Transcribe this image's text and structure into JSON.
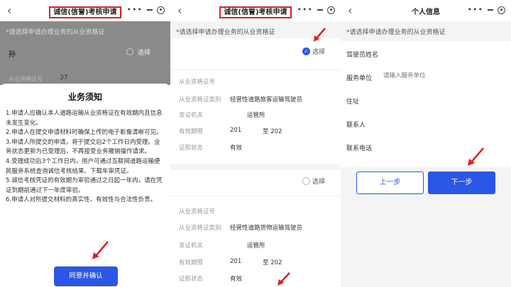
{
  "colors": {
    "accent": "#2b57e6",
    "highlight": "#e02020"
  },
  "screen1": {
    "nav_title": "诚信(信誉)考核申请",
    "hint": "*请选择申请办理业务的从业资格证",
    "dim_name": "孙",
    "dim_select": "选择",
    "dim_label": "从业资格证号",
    "dim_value": "37",
    "notice_title": "业务须知",
    "notice_items": [
      "1.申请人应确认本人道路运输从业资格证在有效期内且信息未发生变化。",
      "2.申请人在提交申请材料时确保上传的电子影像清晰可见。",
      "3.申请人所提交的申请，将于提交后2个工作日内受理。业务状态更新为已受理后，不再接受业务撤销操作请求。",
      "4.受理成功后3个工作日内，用户可通过互联网道路运输便民服务系统查询诚信考核结果、下载年审凭证。",
      "5.诚信考核凭证的有效期为审验通过之日起一年内，请在凭证到期前通过下一年度审验。",
      "6.申请人对所提交材料的真实性、有效性与合法性负责。"
    ],
    "agree_button": "同意并确认"
  },
  "screen2": {
    "nav_title": "诚信(信誉)考核申请",
    "hint": "*请选择申请办理业务的从业资格证",
    "card1": {
      "select": "选择",
      "radio_mark": "✓",
      "rows": [
        {
          "label": "从业资格证号",
          "value": ""
        },
        {
          "label": "从业资格证类别",
          "value": "经营性道路旅客运输驾驶员"
        },
        {
          "label": "发证机关",
          "value": "运管所"
        },
        {
          "label": "有效期限",
          "value": "201",
          "value2": "至 202"
        },
        {
          "label": "证照状态",
          "value": "有效"
        }
      ]
    },
    "card2": {
      "select": "选择",
      "rows": [
        {
          "label": "从业资格证号",
          "value": ""
        },
        {
          "label": "从业资格证类别",
          "value": "经营性道路货物运输驾驶员"
        },
        {
          "label": "发证机关",
          "value": "运管所"
        },
        {
          "label": "有效期限",
          "value": "201",
          "value2": "至 202"
        },
        {
          "label": "证照状态",
          "value": "有效"
        }
      ]
    }
  },
  "screen3": {
    "nav_title": "个人信息",
    "hint": "*请选择申请办理业务的从业资格证",
    "fields": [
      {
        "label": "驾驶员姓名"
      },
      {
        "label": "服务单位",
        "placeholder": "请输入服务单位"
      },
      {
        "label": "住址"
      },
      {
        "label": "联系人"
      },
      {
        "label": "联系电话"
      }
    ],
    "prev_button": "上一步",
    "next_button": "下一步"
  }
}
